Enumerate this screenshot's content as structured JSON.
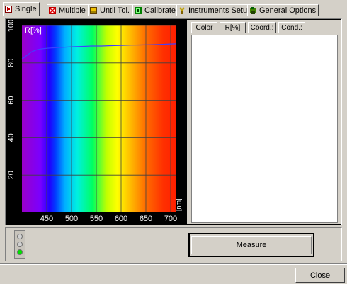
{
  "tabs": [
    {
      "label": "Single",
      "icon": "single-icon",
      "color": "#c00000"
    },
    {
      "label": "Multiple",
      "icon": "multiple-icon",
      "color": "#ff0000"
    },
    {
      "label": "Until Tol.",
      "icon": "until-tol-icon",
      "color": "#806000"
    },
    {
      "label": "Calibrate",
      "icon": "calibrate-icon",
      "color": "#008000"
    },
    {
      "label": "Instruments Setup",
      "icon": "instruments-icon",
      "color": "#c0a000"
    },
    {
      "label": "General Options",
      "icon": "options-icon",
      "color": "#006000"
    }
  ],
  "list_headers": [
    "Color",
    "R[%]",
    "Coord.:",
    "Cond.:"
  ],
  "measure_label": "Measure",
  "close_label": "Close",
  "indicator_lights": [
    "#d0d0d0",
    "#d0d0d0",
    "#00e000"
  ],
  "chart_data": {
    "type": "line",
    "ylabel": "R[%]",
    "xlabel": "[nm]",
    "xlim": [
      400,
      710
    ],
    "ylim": [
      0,
      100
    ],
    "x_ticks": [
      "450",
      "500",
      "550",
      "600",
      "650",
      "700"
    ],
    "y_ticks": [
      "20",
      "40",
      "60",
      "80",
      "100"
    ],
    "series": [
      {
        "color": "#4040ff",
        "x": [
          400,
          410,
          420,
          430,
          440,
          450,
          460,
          480,
          500,
          520,
          540,
          560,
          580,
          600,
          620,
          640,
          660,
          680,
          700,
          710
        ],
        "y": [
          82,
          84,
          86,
          87,
          87.5,
          87.8,
          88,
          88.3,
          88.6,
          88.8,
          89,
          89,
          89.2,
          89.3,
          89.5,
          89.6,
          89.7,
          89.9,
          90.1,
          90.2
        ]
      }
    ],
    "grid": true,
    "background": "visible spectrum"
  }
}
